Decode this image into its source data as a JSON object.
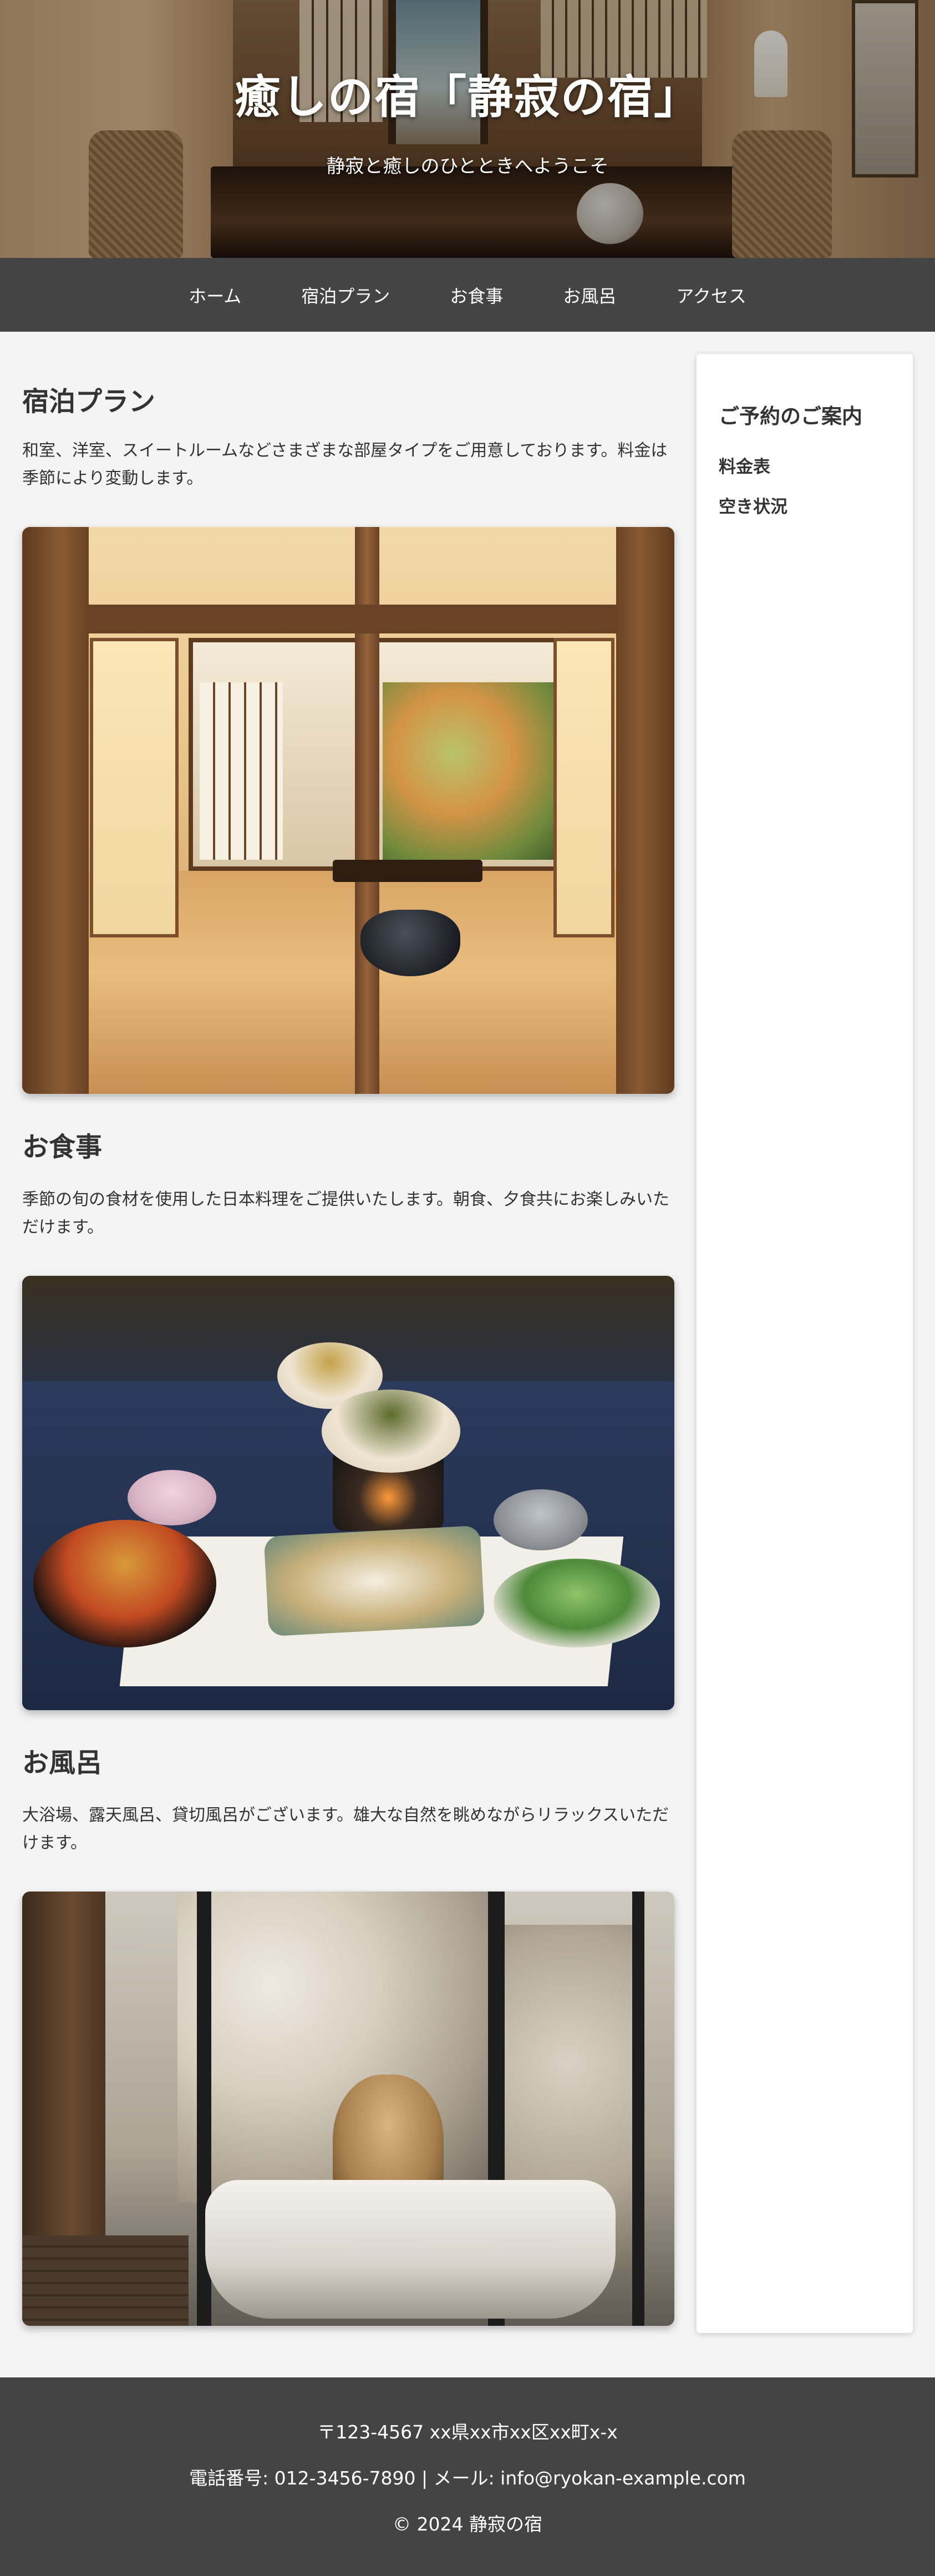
{
  "hero": {
    "title": "癒しの宿「静寂の宿」",
    "subtitle": "静寂と癒しのひとときへようこそ"
  },
  "nav": {
    "items": [
      {
        "label": "ホーム"
      },
      {
        "label": "宿泊プラン"
      },
      {
        "label": "お食事"
      },
      {
        "label": "お風呂"
      },
      {
        "label": "アクセス"
      }
    ]
  },
  "main": {
    "sections": [
      {
        "title": "宿泊プラン",
        "text": "和室、洋室、スイートルームなどさまざまな部屋タイプをご用意しております。料金は季節により変動します。"
      },
      {
        "title": "お食事",
        "text": "季節の旬の食材を使用した日本料理をご提供いたします。朝食、夕食共にお楽しみいただけます。"
      },
      {
        "title": "お風呂",
        "text": "大浴場、露天風呂、貸切風呂がございます。雄大な自然を眺めながらリラックスいただけます。"
      }
    ]
  },
  "sidebar": {
    "title": "ご予約のご案内",
    "links": [
      {
        "label": "料金表"
      },
      {
        "label": "空き状況"
      }
    ]
  },
  "footer": {
    "address": "〒123-4567 xx県xx市xx区xx町x-x",
    "contact": "電話番号: 012-3456-7890 | メール: info@ryokan-example.com",
    "copyright": "© 2024 静寂の宿"
  },
  "colors": {
    "nav_background": "#444444",
    "footer_background": "#444444",
    "page_background": "#f4f4f4",
    "text": "#333333"
  }
}
